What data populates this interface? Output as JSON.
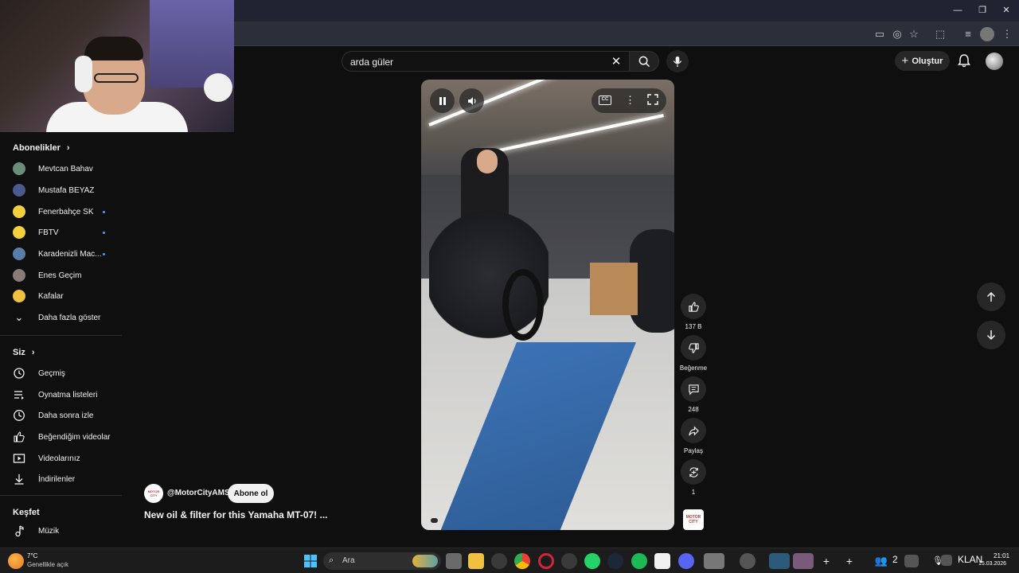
{
  "search": {
    "value": "arda güler"
  },
  "header": {
    "create_label": "Oluştur"
  },
  "sidebar": {
    "subscriptions_title": "Abonelikler",
    "subscriptions": [
      {
        "label": "Mevtcan Bahav",
        "new": false,
        "color": "#6b8e7a"
      },
      {
        "label": "Mustafa BEYAZ",
        "new": false,
        "color": "#4a5a8a"
      },
      {
        "label": "Fenerbahçe SK",
        "new": true,
        "color": "#f4d03f"
      },
      {
        "label": "FBTV",
        "new": true,
        "color": "#f4d03f"
      },
      {
        "label": "Karadenizli Mac...",
        "new": true,
        "color": "#5a7ca8"
      },
      {
        "label": "Enes Geçim",
        "new": false,
        "color": "#8a7a7a"
      },
      {
        "label": "Kafalar",
        "new": false,
        "color": "#f0c040"
      }
    ],
    "show_more": "Daha fazla göster",
    "you_title": "Siz",
    "you_items": [
      {
        "label": "Geçmiş",
        "icon": "history-icon"
      },
      {
        "label": "Oynatma listeleri",
        "icon": "playlist-icon"
      },
      {
        "label": "Daha sonra izle",
        "icon": "watch-later-icon"
      },
      {
        "label": "Beğendiğim videolar",
        "icon": "liked-icon"
      },
      {
        "label": "Videolarınız",
        "icon": "your-videos-icon"
      },
      {
        "label": "İndirilenler",
        "icon": "download-icon"
      }
    ],
    "explore_title": "Keşfet",
    "explore_items": [
      {
        "label": "Müzik",
        "icon": "music-icon"
      }
    ]
  },
  "short": {
    "channel_handle": "@MotorCityAMS",
    "subscribe_label": "Abone ol",
    "title": "New oil & filter for this Yamaha MT-07! ...",
    "likes": "137 B",
    "dislike_label": "Beğenme",
    "comments": "248",
    "share_label": "Paylaş",
    "remix_count": "1",
    "channel_logo_text": "MOTOR CITY"
  },
  "taskbar": {
    "weather_temp": "7°C",
    "weather_desc": "Genellikle açık",
    "search_placeholder": "Ara",
    "people_count": "2",
    "klan": "KLAN",
    "time": "21:01",
    "date": "15.03.2026"
  },
  "colors": {
    "accent": "#3ea6ff",
    "background": "#0f0f0f",
    "surface": "#272727"
  }
}
